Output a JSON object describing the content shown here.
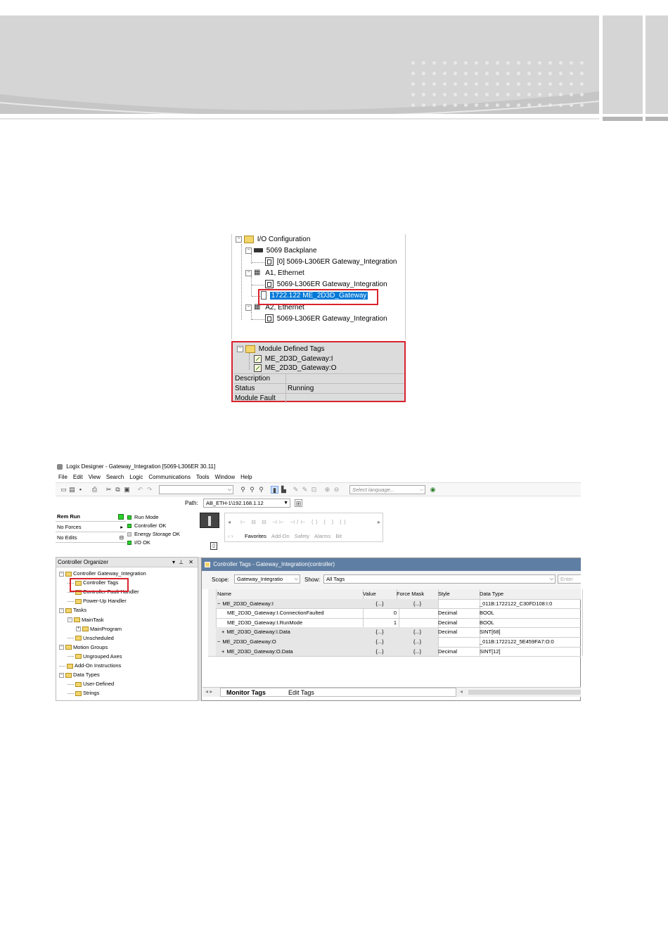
{
  "io_config": {
    "tree": [
      {
        "label": "I/O Configuration"
      },
      {
        "label": "5069 Backplane"
      },
      {
        "label": "[0] 5069-L306ER Gateway_Integration"
      },
      {
        "label": "A1, Ethernet"
      },
      {
        "label": "5069-L306ER Gateway_Integration"
      },
      {
        "label": "1722.122 ME_2D3D_Gateway"
      },
      {
        "label": "A2, Ethernet"
      },
      {
        "label": "5069-L306ER Gateway_Integration"
      }
    ],
    "module_defined_tags": {
      "title": "Module Defined Tags",
      "items": [
        "ME_2D3D_Gateway:I",
        "ME_2D3D_Gateway:O"
      ]
    },
    "properties": [
      {
        "key": "Description",
        "value": ""
      },
      {
        "key": "Status",
        "value": "Running"
      },
      {
        "key": "Module Fault",
        "value": ""
      }
    ]
  },
  "logix": {
    "title": "Logix Designer - Gateway_Integration [5069-L306ER 30.11]",
    "menu": [
      "File",
      "Edit",
      "View",
      "Search",
      "Logic",
      "Communications",
      "Tools",
      "Window",
      "Help"
    ],
    "language_placeholder": "Select language...",
    "path_label": "Path:",
    "path_value": "AB_ETH-1\\192.168.1.12",
    "status": {
      "rows": [
        "Rem Run",
        "No Forces",
        "No Edits"
      ],
      "leds": [
        {
          "label": "Run Mode",
          "on": true
        },
        {
          "label": "Controller OK",
          "on": true
        },
        {
          "label": "Energy Storage OK",
          "on": false
        },
        {
          "label": "I/O OK",
          "on": true
        }
      ]
    },
    "instr_tabs": [
      "Favorites",
      "Add-On",
      "Safety",
      "Alarms",
      "Bit"
    ],
    "organizer": {
      "title": "Controller Organizer",
      "pin": "↓",
      "close": "✕",
      "items": [
        {
          "label": "Controller Gateway_Integration",
          "level": 0
        },
        {
          "label": "Controller Tags",
          "level": 1
        },
        {
          "label": "Controller Fault Handler",
          "level": 1
        },
        {
          "label": "Power-Up Handler",
          "level": 1
        },
        {
          "label": "Tasks",
          "level": 0
        },
        {
          "label": "MainTask",
          "level": 1
        },
        {
          "label": "MainProgram",
          "level": 2
        },
        {
          "label": "Unscheduled",
          "level": 1
        },
        {
          "label": "Motion Groups",
          "level": 0
        },
        {
          "label": "Ungrouped Axes",
          "level": 1
        },
        {
          "label": "Add-On Instructions",
          "level": 0
        },
        {
          "label": "Data Types",
          "level": 0
        },
        {
          "label": "User-Defined",
          "level": 1
        },
        {
          "label": "Strings",
          "level": 1
        }
      ]
    },
    "tags_window": {
      "title": "Controller Tags - Gateway_Integration(controller)",
      "scope_label": "Scope:",
      "scope_value": "Gateway_Integratio",
      "show_label": "Show:",
      "show_value": "All Tags",
      "filter_placeholder": "Enter",
      "columns": [
        "Name",
        "Value",
        "Force Mask",
        "Style",
        "Data Type"
      ],
      "rows": [
        {
          "name": "ME_2D3D_Gateway:I",
          "exp": "−",
          "indent": 0,
          "value": "{...}",
          "force": "{...}",
          "style": "",
          "type": "_011B:1722122_C30FD108:I:0",
          "grey": true
        },
        {
          "name": "ME_2D3D_Gateway:I.ConnectionFaulted",
          "exp": "",
          "indent": 1,
          "value": "0",
          "force": "",
          "style": "Decimal",
          "type": "BOOL",
          "grey": false
        },
        {
          "name": "ME_2D3D_Gateway:I.RunMode",
          "exp": "",
          "indent": 1,
          "value": "1",
          "force": "",
          "style": "Decimal",
          "type": "BOOL",
          "grey": false
        },
        {
          "name": "ME_2D3D_Gateway:I.Data",
          "exp": "+",
          "indent": 1,
          "value": "{...}",
          "force": "{...}",
          "style": "Decimal",
          "type": "SINT[68]",
          "grey": true
        },
        {
          "name": "ME_2D3D_Gateway:O",
          "exp": "−",
          "indent": 0,
          "value": "{...}",
          "force": "{...}",
          "style": "",
          "type": "_011B:1722122_5E459FA7:O:0",
          "grey": true
        },
        {
          "name": "ME_2D3D_Gateway:O.Data",
          "exp": "+",
          "indent": 1,
          "value": "{...}",
          "force": "{...}",
          "style": "Decimal",
          "type": "SINT[12]",
          "grey": true
        }
      ],
      "bottom_tabs": [
        "Monitor Tags",
        "Edit Tags"
      ]
    }
  },
  "colors": {
    "highlight_red": "#d9232e",
    "selection_blue": "#0078d7",
    "led_green": "#2bd12b"
  }
}
